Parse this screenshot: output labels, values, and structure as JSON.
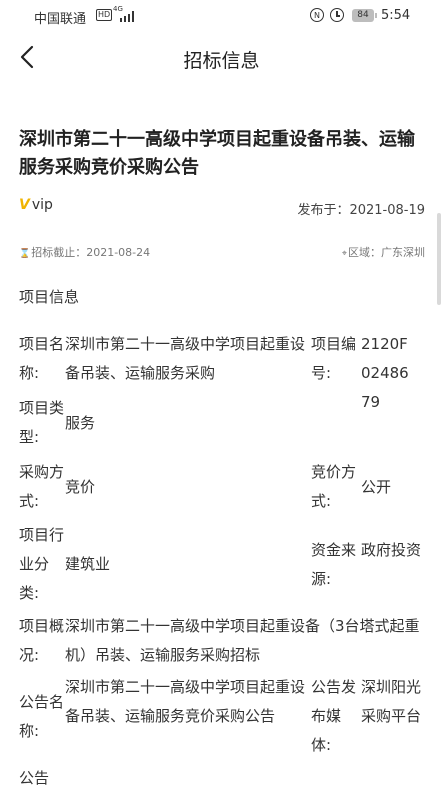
{
  "status_bar": {
    "carrier": "中国联通",
    "hd": "HD",
    "network": "4G",
    "alarm_icon": "alarm-clock-icon",
    "battery": "84",
    "time": "5:54"
  },
  "nav": {
    "title": "招标信息",
    "back_icon": "chevron-left-icon"
  },
  "article": {
    "title": "深圳市第二十一高级中学项目起重设备吊装、运输服务采购竞价采购公告",
    "vip_mark": "V",
    "vip_label": "vip",
    "published": "发布于：2021-08-19",
    "deadline": "招标截止：2021-08-24",
    "region": "区域：广东深圳",
    "section_title": "项目信息"
  },
  "info": {
    "project_name_label": "项目名称:",
    "project_name": "深圳市第二十一高级中学项目起重设备吊装、运输服务采购",
    "project_no_label": "项目编号:",
    "project_no": "2120F0248679",
    "project_type_label": "项目类型:",
    "project_type": "服务",
    "purchase_method_label": "采购方式:",
    "purchase_method": "竞价",
    "bid_method_label": "竞价方式:",
    "bid_method": "公开",
    "industry_label": "项目行业分类:",
    "industry": "建筑业",
    "fund_source_label": "资金来源:",
    "fund_source": "政府投资",
    "overview_label": "项目概况:",
    "overview": "深圳市第二十一高级中学项目起重设备（3台塔式起重机）吊装、运输服务采购招标",
    "notice_name_label": "公告名称:",
    "notice_name": "深圳市第二十一高级中学项目起重设备吊装、运输服务竞价采购公告",
    "media_label": "公告发布媒体:",
    "media": "深圳阳光采购平台",
    "last_label": "公告"
  }
}
